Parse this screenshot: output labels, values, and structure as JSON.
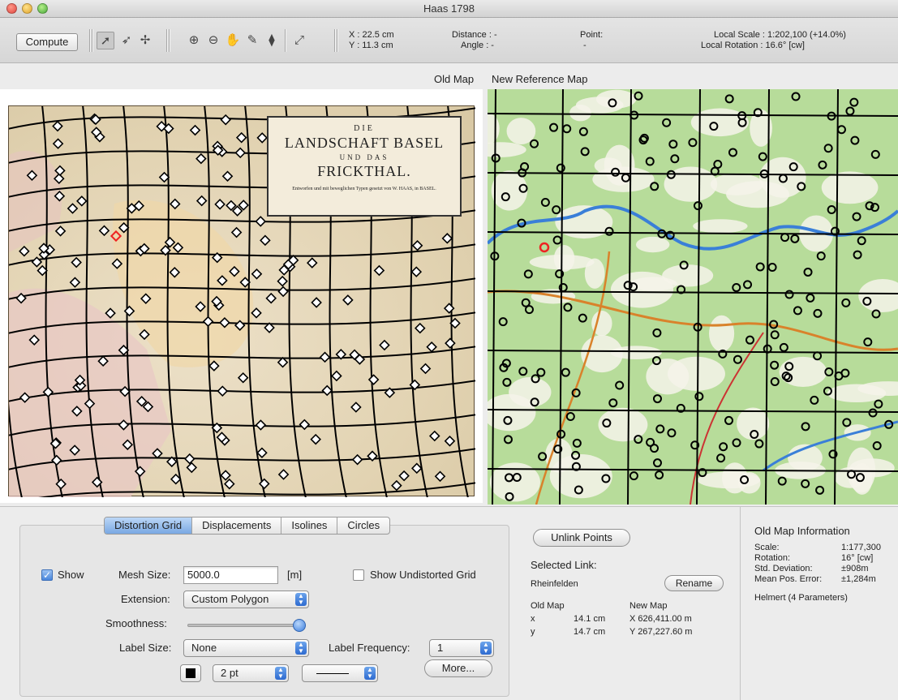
{
  "window": {
    "title": "Haas 1798"
  },
  "toolbar": {
    "compute_label": "Compute",
    "x_readout": "X : 22.5 cm",
    "y_readout": "Y : 11.3 cm",
    "distance_label": "Distance : -",
    "angle_label": "Angle : -",
    "point_label": "Point:",
    "point_value": "-",
    "local_scale": "Local Scale : 1:202,100 (+14.0%)",
    "local_rotation": "Local Rotation : 16.6° [cw]"
  },
  "maps": {
    "old_title": "Old Map",
    "new_title": "New Reference Map",
    "cartouche": {
      "line1": "DIE",
      "line2": "LANDSCHAFT BASEL",
      "line3": "UND DAS",
      "line4": "FRICKTHAL.",
      "line5": "Entworfen und mit beweglichen Typen gesetzt von W. HAAS, in BASEL."
    }
  },
  "tabs": [
    "Distortion Grid",
    "Displacements",
    "Isolines",
    "Circles"
  ],
  "active_tab": "Distortion Grid",
  "grid": {
    "show_label": "Show",
    "show_checked": true,
    "mesh_size_label": "Mesh Size:",
    "mesh_size_value": "5000.0",
    "mesh_unit": "[m]",
    "show_undistorted_label": "Show Undistorted Grid",
    "show_undistorted_checked": false,
    "extension_label": "Extension:",
    "extension_value": "Custom Polygon",
    "smoothness_label": "Smoothness:",
    "smoothness_level": 1.0,
    "label_size_label": "Label Size:",
    "label_size_value": "None",
    "label_frequency_label": "Label Frequency:",
    "label_frequency_value": "1",
    "line_width_value": "2 pt",
    "line_color": "#000000",
    "more_label": "More..."
  },
  "link": {
    "unlink_label": "Unlink Points",
    "selected_link_label": "Selected Link:",
    "name": "Rheinfelden",
    "rename_label": "Rename",
    "old_map_label": "Old Map",
    "new_map_label": "New Map",
    "x_label": "x",
    "y_label": "y",
    "old_x": "14.1 cm",
    "old_y": "14.7 cm",
    "new_x": "X 626,411.00 m",
    "new_y": "Y 267,227.60 m"
  },
  "info": {
    "title": "Old Map Information",
    "scale_label": "Scale:",
    "scale_value": "1:177,300",
    "rotation_label": "Rotation:",
    "rotation_value": "16° [cw]",
    "std_label": "Std. Deviation:",
    "std_value": "±908m",
    "mean_label": "Mean Pos. Error:",
    "mean_value": "±1,284m",
    "method": "Helmert (4 Parameters)"
  }
}
